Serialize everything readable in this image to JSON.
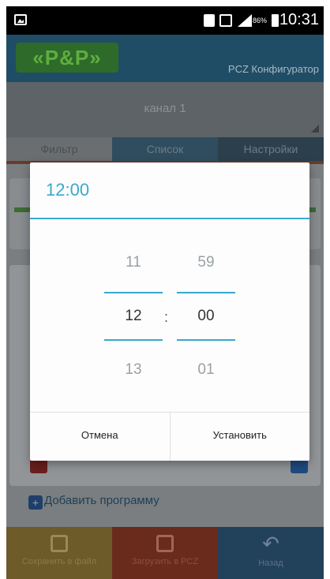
{
  "status_bar": {
    "battery_percent": "86%",
    "time": "10:31"
  },
  "app": {
    "logo_text": "«P&P»",
    "title": "PCZ Конфигуратор",
    "channel_label": "канал 1",
    "tabs": [
      {
        "label": "Фильтр"
      },
      {
        "label": "Список"
      },
      {
        "label": "Настройки"
      }
    ],
    "add_program_label": "Добавить программу"
  },
  "bottom_bar": {
    "save_label": "Сохранить в файл",
    "upload_label": "Загрузить в PCZ",
    "back_label": "Назад"
  },
  "time_dialog": {
    "title": "12:00",
    "hours": {
      "prev": "11",
      "current": "12",
      "next": "13"
    },
    "minutes": {
      "prev": "59",
      "current": "00",
      "next": "01"
    },
    "separator": ":",
    "cancel_label": "Отмена",
    "set_label": "Установить"
  },
  "colors": {
    "accent": "#39a9cc",
    "scrim": "#5f6368"
  }
}
